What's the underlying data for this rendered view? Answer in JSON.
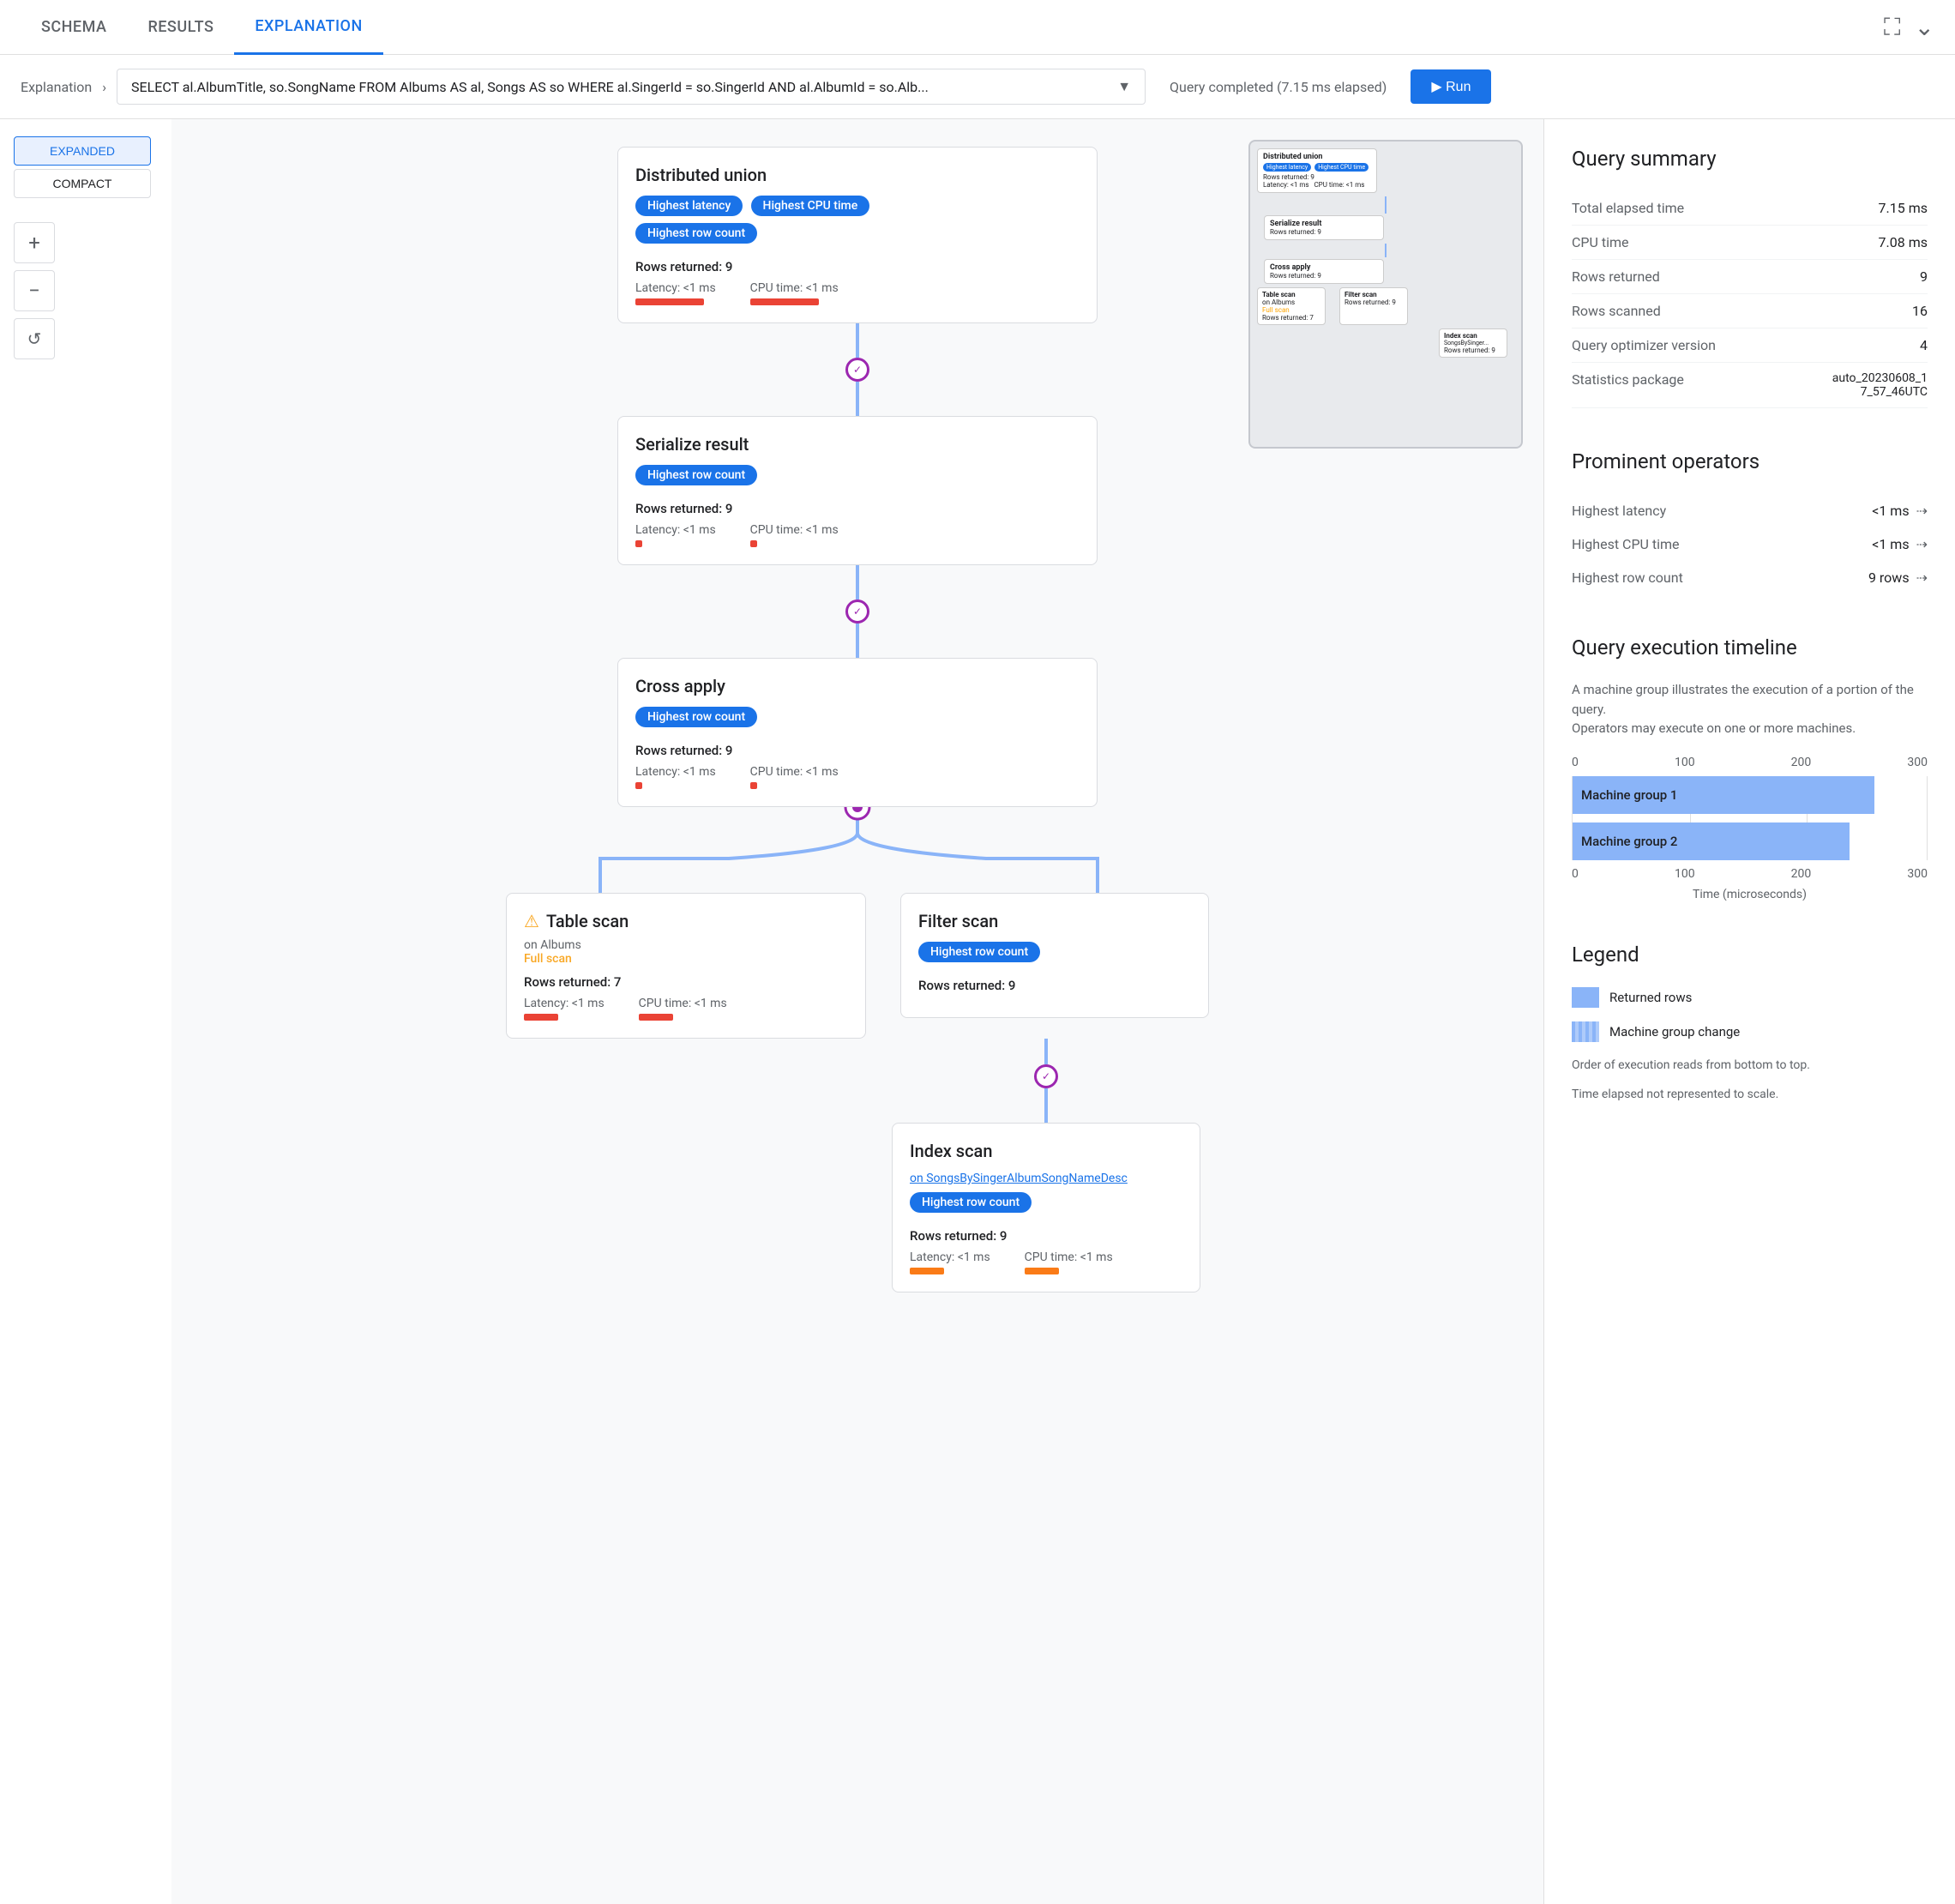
{
  "tabs": {
    "items": [
      {
        "label": "SCHEMA",
        "active": false
      },
      {
        "label": "RESULTS",
        "active": false
      },
      {
        "label": "EXPLANATION",
        "active": true
      }
    ]
  },
  "query_bar": {
    "breadcrumb": "Explanation",
    "query": "SELECT al.AlbumTitle, so.SongName FROM Albums AS al, Songs AS so WHERE al.SingerId = so.SingerId AND al.AlbumId = so.Alb...",
    "status": "Query completed (7.15 ms elapsed)"
  },
  "view_buttons": {
    "expanded": "EXPANDED",
    "compact": "COMPACT"
  },
  "zoom": {
    "plus": "+",
    "minus": "−",
    "refresh": "↺"
  },
  "nodes": {
    "distributed_union": {
      "title": "Distributed union",
      "badge1": "Highest latency",
      "badge2": "Highest CPU time",
      "badge3": "Highest row count",
      "rows": "Rows returned: 9",
      "latency": "Latency: <1 ms",
      "cpu": "CPU time: <1 ms"
    },
    "serialize_result": {
      "title": "Serialize result",
      "badge": "Highest row count",
      "rows": "Rows returned: 9",
      "latency": "Latency: <1 ms",
      "cpu": "CPU time: <1 ms"
    },
    "cross_apply": {
      "title": "Cross apply",
      "badge": "Highest row count",
      "rows": "Rows returned: 9",
      "latency": "Latency: <1 ms",
      "cpu": "CPU time: <1 ms"
    },
    "table_scan": {
      "title": "Table scan",
      "subtitle1": "on Albums",
      "subtitle2": "Full scan",
      "rows": "Rows returned: 7",
      "latency": "Latency: <1 ms",
      "cpu": "CPU time: <1 ms",
      "warning": true
    },
    "filter_scan": {
      "title": "Filter scan",
      "badge": "Highest row count",
      "rows": "Rows returned: 9",
      "latency": "",
      "cpu": ""
    },
    "index_scan": {
      "title": "Index scan",
      "subtitle1": "on SongsBySingerAlbumSongNameDesc",
      "badge": "Highest row count",
      "rows": "Rows returned: 9",
      "latency": "Latency: <1 ms",
      "cpu": "CPU time: <1 ms"
    }
  },
  "query_summary": {
    "title": "Query summary",
    "rows": [
      {
        "label": "Total elapsed time",
        "value": "7.15 ms"
      },
      {
        "label": "CPU time",
        "value": "7.08 ms"
      },
      {
        "label": "Rows returned",
        "value": "9"
      },
      {
        "label": "Rows scanned",
        "value": "16"
      },
      {
        "label": "Query optimizer version",
        "value": "4"
      },
      {
        "label": "Statistics package",
        "value": "auto_20230608_17_57_46UTC"
      }
    ]
  },
  "prominent_operators": {
    "title": "Prominent operators",
    "items": [
      {
        "label": "Highest latency",
        "value": "<1 ms"
      },
      {
        "label": "Highest CPU time",
        "value": "<1 ms"
      },
      {
        "label": "Highest row count",
        "value": "9 rows"
      }
    ]
  },
  "execution_timeline": {
    "title": "Query execution timeline",
    "description": "A machine group illustrates the execution of a portion of the query. Operators may execute on one or more machines.",
    "axis_labels": [
      "0",
      "100",
      "200",
      "300"
    ],
    "bars": [
      {
        "label": "Machine group 1",
        "width_pct": 85
      },
      {
        "label": "Machine group 2",
        "width_pct": 78
      }
    ],
    "unit": "Time (microseconds)"
  },
  "legend": {
    "title": "Legend",
    "items": [
      {
        "label": "Returned rows",
        "type": "solid"
      },
      {
        "label": "Machine group change",
        "type": "striped"
      }
    ],
    "note1": "Order of execution reads from bottom to top.",
    "note2": "Time elapsed not represented to scale."
  }
}
